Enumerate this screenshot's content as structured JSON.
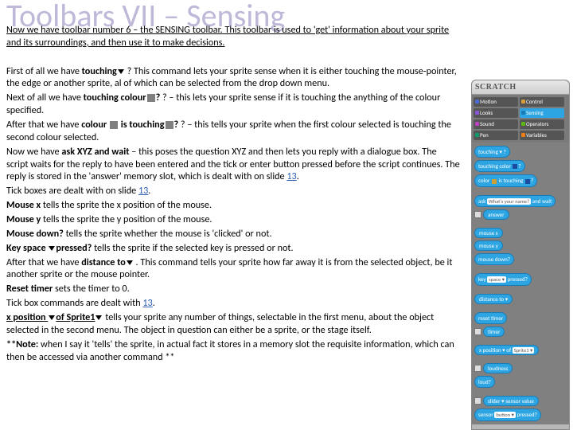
{
  "title": "Toolbars VII – Sensing",
  "intro1": "Now we have toolbar number 6 – the ",
  "intro_sensing": "SENSING toolbar.",
  "intro2": "  This toolbar is used to 'get' information about your sprite and its surroundings, and then use it to make decisions.",
  "p_touching1": "First of all we have ",
  "p_touching_b": "touching",
  "p_touching2": " ?  This command lets your sprite sense when it is either touching the mouse-pointer, the edge or another sprite, al of which can be selected from the drop down menu.",
  "p_tcolour1": "Next of all we have ",
  "p_tcolour_b": "touching colour",
  "p_tcolour2": " ? – this lets your sprite sense if it is touching the anything of the colour specified.",
  "p_colis1": "After that we have ",
  "p_colis_b1": "colour ",
  "p_colis_b2": " is touching",
  "p_colis2": " ? – this tells your sprite when the first colour selected is touching the second colour selected.",
  "p_ask1": "Now we have ",
  "p_ask_b": "ask XYZ and wait",
  "p_ask2": " – this poses the question XYZ and then lets you reply with a dialogue box.  The script waits for the reply to have been entered and the tick or enter button pressed before the script continues.  The reply is stored in the 'answer' memory slot, which is dealt with on slide ",
  "link13": "13",
  "period": ".",
  "p_tick": "Tick boxes are dealt with on slide ",
  "p_mx_b": "Mouse x",
  "p_mx": " tells the sprite the x position of the mouse.",
  "p_my_b": "Mouse y",
  "p_my": " tells the sprite the y position of the mouse.",
  "p_md_b": "Mouse down?",
  "p_md": " tells the sprite whether the mouse is 'clicked' or not.",
  "p_key_b1": "Key space ",
  "p_key_b2": "pressed?",
  "p_key": " tells the sprite if the selected key is pressed or not.",
  "p_dist1": "After that we have ",
  "p_dist_b": "distance to",
  "p_dist2": " .  This command tells your sprite how far away it is from the selected object, be it another sprite or the mouse pointer.",
  "p_reset_b": "Reset timer",
  "p_reset": " sets the timer to 0.",
  "p_tick2": "Tick box commands are dealt with ",
  "p_xpos_b1": "x position ",
  "p_xpos_b2": "of Sprite1",
  "p_xpos": "  tells your sprite any number of things, selectable in the first menu, about the object selected in the second menu.  The object in question can either be a sprite, or the stage itself.",
  "p_note_b": "**Note:",
  "p_note": " when I say it 'tells' the sprite, in actual fact it stores in a memory slot the requisite information, which can then be accessed via another command **",
  "sidebar": {
    "logo": "SCRATCH",
    "cats": {
      "motion": "Motion",
      "control": "Control",
      "looks": "Looks",
      "sensing": "Sensing",
      "sound": "Sound",
      "operators": "Operators",
      "pen": "Pen",
      "variables": "Variables"
    },
    "blocks": {
      "touching": "touching ▾ ?",
      "touching_color": "touching color",
      "color_is": "color",
      "is_touching": "is touching",
      "ask": "ask",
      "ask_q": "What's your name?",
      "and_wait": "and wait",
      "answer": "answer",
      "mousex": "mouse x",
      "mousey": "mouse y",
      "mousedown": "mouse down?",
      "key": "key",
      "space": "space ▾",
      "pressed": "pressed?",
      "distance": "distance to ▾",
      "reset": "reset timer",
      "timer": "timer",
      "xposition": "x position ▾",
      "of": "of",
      "sprite1": "Sprite1 ▾",
      "loudness": "loudness",
      "loud": "loud?",
      "sensor": "sensor",
      "slider": "slider ▾",
      "value": "value",
      "sensor2": "sensor",
      "button": "button ▾",
      "pressed2": "pressed?"
    }
  }
}
